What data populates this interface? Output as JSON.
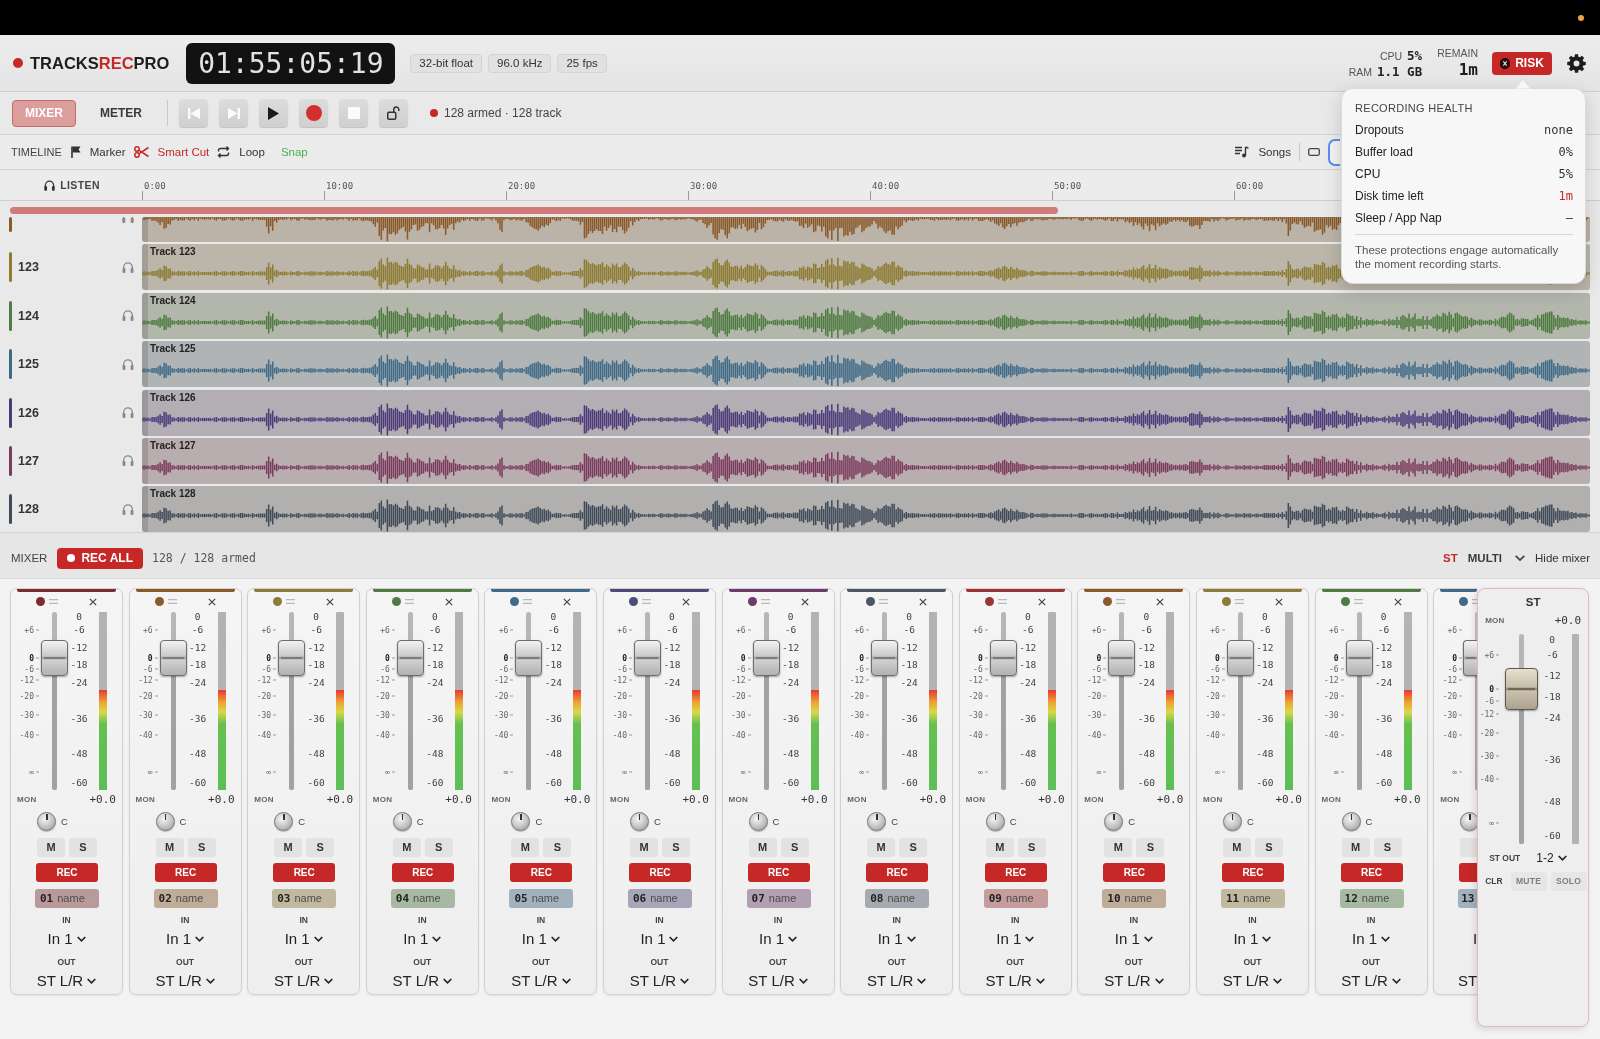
{
  "header": {
    "logo": {
      "before": "TRACKS",
      "accent": "REC",
      "after": "PRO"
    },
    "timecode": "01:55:05:19",
    "badges": [
      "32-bit float",
      "96.0 kHz",
      "25 fps"
    ],
    "stats": [
      {
        "label": "CPU",
        "value": "5%"
      },
      {
        "label": "RAM",
        "value": "1.1 GB"
      }
    ],
    "remain": {
      "label": "REMAIN",
      "value": "1m"
    },
    "risk_button": "RISK"
  },
  "toolbar": {
    "tabs": [
      {
        "label": "MIXER",
        "selected": true
      },
      {
        "label": "METER",
        "selected": false
      }
    ],
    "transport": [
      {
        "kind": "skip-back"
      },
      {
        "kind": "skip-forward"
      },
      {
        "kind": "play"
      },
      {
        "kind": "record"
      },
      {
        "kind": "stop"
      },
      {
        "kind": "lock"
      }
    ],
    "armed_status": "128 armed · 128 track"
  },
  "timeline_bar": {
    "title": "TIMELINE",
    "tools": [
      {
        "kind": "marker",
        "label": "Marker",
        "on": false
      },
      {
        "kind": "cut",
        "label": "Smart Cut",
        "on": true,
        "color": "#c62828"
      },
      {
        "kind": "loop",
        "label": "Loop",
        "on": false
      },
      {
        "kind": "snap",
        "label": "Snap",
        "on": true,
        "color": "#4caf50"
      }
    ],
    "songs": "Songs"
  },
  "ruler": {
    "listen": "LISTEN",
    "ticks": [
      "0:00",
      "10:00",
      "20:00",
      "30:00",
      "40:00",
      "50:00",
      "60:00"
    ]
  },
  "tracks": [
    {
      "color": "#8b5a2b"
    },
    {
      "number": "123",
      "label": "Track 123",
      "color": "#8c7b30"
    },
    {
      "number": "124",
      "label": "Track 124",
      "color": "#4e7b40"
    },
    {
      "number": "125",
      "label": "Track 125",
      "color": "#3f6a88"
    },
    {
      "number": "126",
      "label": "Track 126",
      "color": "#4b3b7b"
    },
    {
      "number": "127",
      "label": "Track 127",
      "color": "#7b3b5e"
    },
    {
      "number": "128",
      "label": "Track 128",
      "color": "#3f4b59"
    }
  ],
  "mixer": {
    "title": "MIXER",
    "rec_all": "REC ALL",
    "armed": "128 / 128 armed",
    "views": [
      {
        "label": "ST",
        "selected": true
      },
      {
        "label": "MULTI",
        "selected": false
      }
    ],
    "hide": "Hide mixer",
    "strips": [
      {
        "kind": "full",
        "number": "01",
        "placeholder": "name",
        "color": "#7b2d2d",
        "fader": {
          "level": 0.74
        },
        "meter": {
          "level": 0.56
        },
        "fader_scale": [
          "+6",
          "0",
          "-6",
          "-12",
          "-20",
          "-30",
          "-40",
          "∞"
        ],
        "meter_scale": [
          "0",
          "-6",
          "-12",
          "-18",
          "-24",
          "-36",
          "-48",
          "-60"
        ],
        "mon": "MON",
        "gain": "+0.0",
        "pan": "C",
        "mute": {
          "label": "M",
          "on": false
        },
        "solo": {
          "label": "S",
          "on": false
        },
        "rec": {
          "label": "REC",
          "on": true
        },
        "in_label": "IN",
        "input": "In 1",
        "out_label": "OUT",
        "output": "ST L/R"
      },
      {
        "kind": "full",
        "number": "02",
        "placeholder": "name",
        "color": "#8b5a2b",
        "fader": {
          "level": 0.74
        },
        "meter": {
          "level": 0.56
        },
        "fader_scale": [
          "+6",
          "0",
          "-6",
          "-12",
          "-20",
          "-30",
          "-40",
          "∞"
        ],
        "meter_scale": [
          "0",
          "-6",
          "-12",
          "-18",
          "-24",
          "-36",
          "-48",
          "-60"
        ],
        "mon": "MON",
        "gain": "+0.0",
        "pan": "C",
        "mute": {
          "label": "M",
          "on": false
        },
        "solo": {
          "label": "S",
          "on": false
        },
        "rec": {
          "label": "REC",
          "on": true
        },
        "in_label": "IN",
        "input": "In 1",
        "out_label": "OUT",
        "output": "ST L/R"
      },
      {
        "kind": "full",
        "number": "03",
        "placeholder": "name",
        "color": "#8c7b3a",
        "fader": {
          "level": 0.74
        },
        "meter": {
          "level": 0.56
        },
        "fader_scale": [
          "+6",
          "0",
          "-6",
          "-12",
          "-20",
          "-30",
          "-40",
          "∞"
        ],
        "meter_scale": [
          "0",
          "-6",
          "-12",
          "-18",
          "-24",
          "-36",
          "-48",
          "-60"
        ],
        "mon": "MON",
        "gain": "+0.0",
        "pan": "C",
        "mute": {
          "label": "M",
          "on": false
        },
        "solo": {
          "label": "S",
          "on": false
        },
        "rec": {
          "label": "REC",
          "on": true
        },
        "in_label": "IN",
        "input": "In 1",
        "out_label": "OUT",
        "output": "ST L/R"
      },
      {
        "kind": "full",
        "number": "04",
        "placeholder": "name",
        "color": "#4e7b45",
        "fader": {
          "level": 0.74
        },
        "meter": {
          "level": 0.56
        },
        "fader_scale": [
          "+6",
          "0",
          "-6",
          "-12",
          "-20",
          "-30",
          "-40",
          "∞"
        ],
        "meter_scale": [
          "0",
          "-6",
          "-12",
          "-18",
          "-24",
          "-36",
          "-48",
          "-60"
        ],
        "mon": "MON",
        "gain": "+0.0",
        "pan": "C",
        "mute": {
          "label": "M",
          "on": false
        },
        "solo": {
          "label": "S",
          "on": false
        },
        "rec": {
          "label": "REC",
          "on": true
        },
        "in_label": "IN",
        "input": "In 1",
        "out_label": "OUT",
        "output": "ST L/R"
      },
      {
        "kind": "full",
        "number": "05",
        "placeholder": "name",
        "color": "#3f6a88",
        "fader": {
          "level": 0.74
        },
        "meter": {
          "level": 0.56
        },
        "fader_scale": [
          "+6",
          "0",
          "-6",
          "-12",
          "-20",
          "-30",
          "-40",
          "∞"
        ],
        "meter_scale": [
          "0",
          "-6",
          "-12",
          "-18",
          "-24",
          "-36",
          "-48",
          "-60"
        ],
        "mon": "MON",
        "gain": "+0.0",
        "pan": "C",
        "mute": {
          "label": "M",
          "on": false
        },
        "solo": {
          "label": "S",
          "on": false
        },
        "rec": {
          "label": "REC",
          "on": true
        },
        "in_label": "IN",
        "input": "In 1",
        "out_label": "OUT",
        "output": "ST L/R"
      },
      {
        "kind": "full",
        "number": "06",
        "placeholder": "name",
        "color": "#4b4b78",
        "fader": {
          "level": 0.74
        },
        "meter": {
          "level": 0.56
        },
        "fader_scale": [
          "+6",
          "0",
          "-6",
          "-12",
          "-20",
          "-30",
          "-40",
          "∞"
        ],
        "meter_scale": [
          "0",
          "-6",
          "-12",
          "-18",
          "-24",
          "-36",
          "-48",
          "-60"
        ],
        "mon": "MON",
        "gain": "+0.0",
        "pan": "C",
        "mute": {
          "label": "M",
          "on": false
        },
        "solo": {
          "label": "S",
          "on": false
        },
        "rec": {
          "label": "REC",
          "on": true
        },
        "in_label": "IN",
        "input": "In 1",
        "out_label": "OUT",
        "output": "ST L/R"
      },
      {
        "kind": "full",
        "number": "07",
        "placeholder": "name",
        "color": "#6b3b6b",
        "fader": {
          "level": 0.74
        },
        "meter": {
          "level": 0.56
        },
        "fader_scale": [
          "+6",
          "0",
          "-6",
          "-12",
          "-20",
          "-30",
          "-40",
          "∞"
        ],
        "meter_scale": [
          "0",
          "-6",
          "-12",
          "-18",
          "-24",
          "-36",
          "-48",
          "-60"
        ],
        "mon": "MON",
        "gain": "+0.0",
        "pan": "C",
        "mute": {
          "label": "M",
          "on": false
        },
        "solo": {
          "label": "S",
          "on": false
        },
        "rec": {
          "label": "REC",
          "on": true
        },
        "in_label": "IN",
        "input": "In 1",
        "out_label": "OUT",
        "output": "ST L/R"
      },
      {
        "kind": "full",
        "number": "08",
        "placeholder": "name",
        "color": "#4b5766",
        "fader": {
          "level": 0.74
        },
        "meter": {
          "level": 0.56
        },
        "fader_scale": [
          "+6",
          "0",
          "-6",
          "-12",
          "-20",
          "-30",
          "-40",
          "∞"
        ],
        "meter_scale": [
          "0",
          "-6",
          "-12",
          "-18",
          "-24",
          "-36",
          "-48",
          "-60"
        ],
        "mon": "MON",
        "gain": "+0.0",
        "pan": "C",
        "mute": {
          "label": "M",
          "on": false
        },
        "solo": {
          "label": "S",
          "on": false
        },
        "rec": {
          "label": "REC",
          "on": true
        },
        "in_label": "IN",
        "input": "In 1",
        "out_label": "OUT",
        "output": "ST L/R"
      },
      {
        "kind": "full",
        "number": "09",
        "placeholder": "name",
        "color": "#9b3434",
        "fader": {
          "level": 0.74
        },
        "meter": {
          "level": 0.56
        },
        "fader_scale": [
          "+6",
          "0",
          "-6",
          "-12",
          "-20",
          "-30",
          "-40",
          "∞"
        ],
        "meter_scale": [
          "0",
          "-6",
          "-12",
          "-18",
          "-24",
          "-36",
          "-48",
          "-60"
        ],
        "mon": "MON",
        "gain": "+0.0",
        "pan": "C",
        "mute": {
          "label": "M",
          "on": false
        },
        "solo": {
          "label": "S",
          "on": false
        },
        "rec": {
          "label": "REC",
          "on": true
        },
        "in_label": "IN",
        "input": "In 1",
        "out_label": "OUT",
        "output": "ST L/R"
      },
      {
        "kind": "full",
        "number": "10",
        "placeholder": "name",
        "color": "#8b5a2b",
        "fader": {
          "level": 0.74
        },
        "meter": {
          "level": 0.56
        },
        "fader_scale": [
          "+6",
          "0",
          "-6",
          "-12",
          "-20",
          "-30",
          "-40",
          "∞"
        ],
        "meter_scale": [
          "0",
          "-6",
          "-12",
          "-18",
          "-24",
          "-36",
          "-48",
          "-60"
        ],
        "mon": "MON",
        "gain": "+0.0",
        "pan": "C",
        "mute": {
          "label": "M",
          "on": false
        },
        "solo": {
          "label": "S",
          "on": false
        },
        "rec": {
          "label": "REC",
          "on": true
        },
        "in_label": "IN",
        "input": "In 1",
        "out_label": "OUT",
        "output": "ST L/R"
      },
      {
        "kind": "full",
        "number": "11",
        "placeholder": "name",
        "color": "#8c7b3a",
        "fader": {
          "level": 0.74
        },
        "meter": {
          "level": 0.56
        },
        "fader_scale": [
          "+6",
          "0",
          "-6",
          "-12",
          "-20",
          "-30",
          "-40",
          "∞"
        ],
        "meter_scale": [
          "0",
          "-6",
          "-12",
          "-18",
          "-24",
          "-36",
          "-48",
          "-60"
        ],
        "mon": "MON",
        "gain": "+0.0",
        "pan": "C",
        "mute": {
          "label": "M",
          "on": false
        },
        "solo": {
          "label": "S",
          "on": false
        },
        "rec": {
          "label": "REC",
          "on": true
        },
        "in_label": "IN",
        "input": "In 1",
        "out_label": "OUT",
        "output": "ST L/R"
      },
      {
        "kind": "full",
        "number": "12",
        "placeholder": "name",
        "color": "#4e7b45",
        "fader": {
          "level": 0.74
        },
        "meter": {
          "level": 0.56
        },
        "fader_scale": [
          "+6",
          "0",
          "-6",
          "-12",
          "-20",
          "-30",
          "-40",
          "∞"
        ],
        "meter_scale": [
          "0",
          "-6",
          "-12",
          "-18",
          "-24",
          "-36",
          "-48",
          "-60"
        ],
        "mon": "MON",
        "gain": "+0.0",
        "pan": "C",
        "mute": {
          "label": "M",
          "on": false
        },
        "solo": {
          "label": "S",
          "on": false
        },
        "rec": {
          "label": "REC",
          "on": true
        },
        "in_label": "IN",
        "input": "In 1",
        "out_label": "OUT",
        "output": "ST L/R"
      },
      {
        "kind": "partial",
        "number": "13",
        "color": "#3f6a88",
        "fader": {
          "level": 0.74
        },
        "fader_scale": [
          "+6",
          "0",
          "-6",
          "-12",
          "-20",
          "-30",
          "-40",
          "∞"
        ],
        "mon": "MON",
        "mute": {
          "on": false
        },
        "rec": {
          "on": true
        },
        "input": "I",
        "output": "ST"
      }
    ],
    "master": {
      "title": "ST",
      "mon": "MON",
      "gain": "+0.0",
      "fader": {
        "level": 0.74
      },
      "fader_scale": [
        "+6",
        "0",
        "-6",
        "-12",
        "-20",
        "-30",
        "-40",
        "∞"
      ],
      "meter_scale": [
        "0",
        "-6",
        "-12",
        "-18",
        "-24",
        "-36",
        "-48",
        "-60"
      ],
      "out_label": "ST OUT",
      "output": "1-2",
      "clr": "CLR",
      "buttons": [
        {
          "label": "MUTE",
          "disabled": true
        },
        {
          "label": "SOLO",
          "disabled": true
        }
      ]
    }
  },
  "health": {
    "title": "RECORDING HEALTH",
    "rows": [
      {
        "label": "Dropouts",
        "value": "none",
        "alert": false
      },
      {
        "label": "Buffer load",
        "value": "0%",
        "alert": false
      },
      {
        "label": "CPU",
        "value": "5%",
        "alert": false
      },
      {
        "label": "Disk time left",
        "value": "1m",
        "alert": true
      },
      {
        "label": "Sleep / App Nap",
        "value": "–",
        "alert": false
      }
    ],
    "note": "These protections engage automatically the moment recording starts."
  }
}
